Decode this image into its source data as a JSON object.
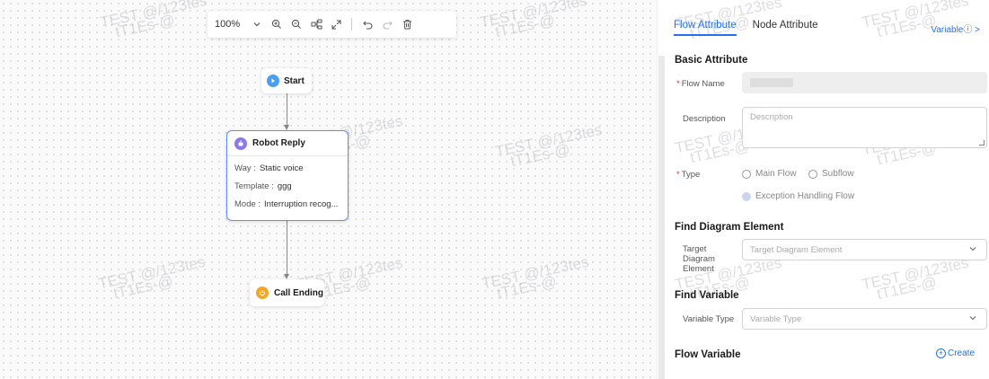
{
  "toolbar": {
    "zoom": "100%",
    "icons": [
      "chevron-down-icon",
      "zoom-in-icon",
      "zoom-out-icon",
      "layout-icon",
      "fullscreen-icon",
      "undo-icon",
      "redo-icon",
      "delete-icon"
    ]
  },
  "watermark": "TEST @/123tes\n   tT1Es-@",
  "nodes": {
    "start": {
      "label": "Start",
      "color": "#4a9ff5"
    },
    "reply": {
      "title": "Robot Reply",
      "color": "#8b79e8",
      "rows": [
        {
          "key": "Way :",
          "value": "Static voice"
        },
        {
          "key": "Template :",
          "value": "ggg"
        },
        {
          "key": "Mode :",
          "value": "Interruption recog..."
        }
      ]
    },
    "end": {
      "label": "Call Ending",
      "color": "#f5a623"
    }
  },
  "panel": {
    "tabs": [
      "Flow Attribute",
      "Node Attribute"
    ],
    "variable_link": "Variableⓘ >",
    "basic_title": "Basic Attribute",
    "flow_name_label": "Flow Name",
    "flow_name_value": "",
    "description_label": "Description",
    "description_placeholder": "Description",
    "type_label": "Type",
    "type_options": [
      "Main Flow",
      "Subflow",
      "Exception Handling Flow"
    ],
    "find_element_title": "Find Diagram Element",
    "target_label": "Target Diagram Element",
    "target_placeholder": "Target Diagram Element",
    "find_variable_title": "Find Variable",
    "variable_type_label": "Variable Type",
    "variable_type_placeholder": "Variable Type",
    "flow_variable_title": "Flow Variable",
    "create_label": "Create",
    "accent": "#2470f0"
  }
}
